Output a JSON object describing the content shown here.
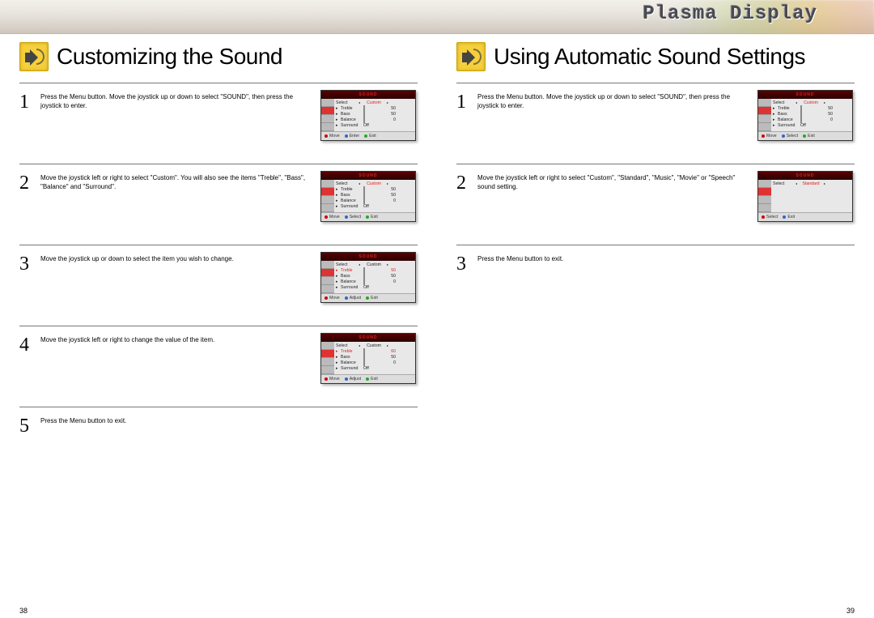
{
  "brand": "Plasma Display",
  "left": {
    "title": "Customizing the Sound",
    "page_number": "38",
    "steps": [
      {
        "num": "1",
        "text": "Press the Menu button. Move the joystick up or down to select \"SOUND\", then press the joystick to enter.",
        "osd": {
          "title": "SOUND",
          "select_row": {
            "label": "Select",
            "value": "Custom",
            "highlight_value": true
          },
          "rows": [
            {
              "label": "Treble",
              "bar": 50,
              "num": "50"
            },
            {
              "label": "Bass",
              "bar": 50,
              "num": "50"
            },
            {
              "label": "Balance",
              "bar": 0,
              "num": "0"
            },
            {
              "label": "Surround",
              "text": "Off"
            }
          ],
          "footer": [
            "Move",
            "Enter",
            "Exit"
          ]
        }
      },
      {
        "num": "2",
        "text": "Move the joystick left or right to select \"Custom\". You will also see the items \"Treble\", \"Bass\", \"Balance\" and \"Surround\".",
        "osd": {
          "title": "SOUND",
          "select_row": {
            "label": "Select",
            "value": "Custom",
            "highlight_value": true
          },
          "rows": [
            {
              "label": "Treble",
              "bar": 50,
              "num": "50"
            },
            {
              "label": "Bass",
              "bar": 50,
              "num": "50"
            },
            {
              "label": "Balance",
              "bar": 0,
              "num": "0"
            },
            {
              "label": "Surround",
              "text": "Off"
            }
          ],
          "footer": [
            "Move",
            "Select",
            "Exit"
          ]
        }
      },
      {
        "num": "3",
        "text": "Move the joystick up or down to select the item you wish to change.",
        "osd": {
          "title": "SOUND",
          "select_row": {
            "label": "Select",
            "value": "Custom"
          },
          "rows": [
            {
              "label": "Treble",
              "bar": 50,
              "num": "50",
              "highlight": true
            },
            {
              "label": "Bass",
              "bar": 50,
              "num": "50"
            },
            {
              "label": "Balance",
              "bar": 0,
              "num": "0"
            },
            {
              "label": "Surround",
              "text": "Off"
            }
          ],
          "footer": [
            "Move",
            "Adjust",
            "Exit"
          ]
        }
      },
      {
        "num": "4",
        "text": "Move the joystick left or right to change the value of the item.",
        "osd": {
          "title": "SOUND",
          "select_row": {
            "label": "Select",
            "value": "Custom"
          },
          "rows": [
            {
              "label": "Treble",
              "bar": 60,
              "num": "60",
              "highlight": true
            },
            {
              "label": "Bass",
              "bar": 50,
              "num": "50"
            },
            {
              "label": "Balance",
              "bar": 0,
              "num": "0"
            },
            {
              "label": "Surround",
              "text": "Off"
            }
          ],
          "footer": [
            "Move",
            "Adjust",
            "Exit"
          ]
        }
      },
      {
        "num": "5",
        "text": "Press the Menu button to exit.",
        "osd": null
      }
    ]
  },
  "right": {
    "title": "Using Automatic Sound Settings",
    "page_number": "39",
    "steps": [
      {
        "num": "1",
        "text": "Press the Menu button. Move the joystick up or down to select \"SOUND\", then press the joystick to enter.",
        "osd": {
          "title": "SOUND",
          "select_row": {
            "label": "Select",
            "value": "Custom",
            "highlight_value": true
          },
          "rows": [
            {
              "label": "Treble",
              "bar": 50,
              "num": "50"
            },
            {
              "label": "Bass",
              "bar": 50,
              "num": "50"
            },
            {
              "label": "Balance",
              "bar": 0,
              "num": "0"
            },
            {
              "label": "Surround",
              "text": "Off"
            }
          ],
          "footer": [
            "Move",
            "Select",
            "Exit"
          ]
        }
      },
      {
        "num": "2",
        "text": "Move the joystick left or right to select \"Custom\", \"Standard\", \"Music\", \"Movie\" or \"Speech\" sound setting.",
        "osd": {
          "title": "SOUND",
          "select_row": {
            "label": "Select",
            "value": "Standard",
            "highlight_value": true
          },
          "rows": [],
          "footer": [
            "Select",
            "Exit"
          ]
        }
      },
      {
        "num": "3",
        "text": "Press the Menu button to exit.",
        "osd": null
      }
    ]
  }
}
